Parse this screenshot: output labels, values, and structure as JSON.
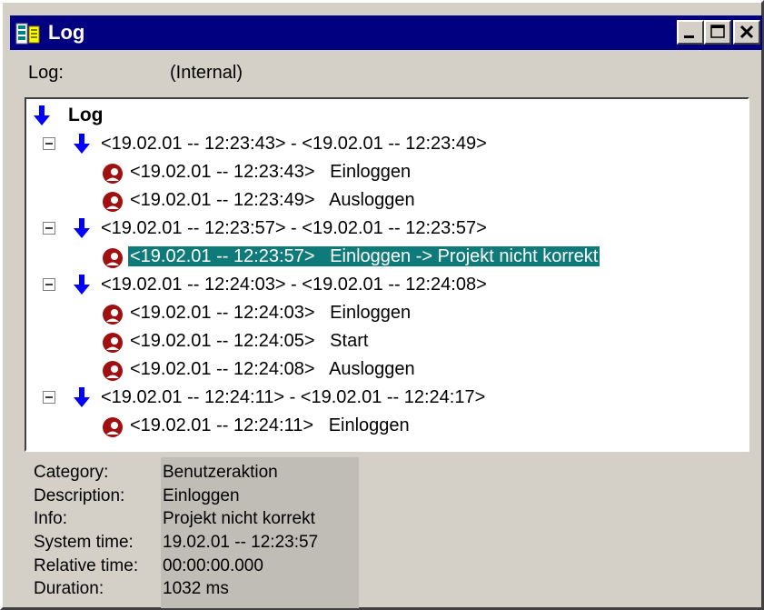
{
  "window": {
    "title": "Log",
    "icon": "log-book-icon",
    "controls": [
      "minimize-icon",
      "maximize-icon",
      "close-icon"
    ]
  },
  "log_selector": {
    "label": "Log:",
    "value": "(Internal)"
  },
  "tree": {
    "root_label": "Log",
    "groups": [
      {
        "label": "<19.02.01 -- 12:23:43> - <19.02.01 -- 12:23:49>",
        "entries": [
          {
            "time": "<19.02.01 -- 12:23:43>",
            "action": "Einloggen"
          },
          {
            "time": "<19.02.01 -- 12:23:49>",
            "action": "Ausloggen"
          }
        ]
      },
      {
        "label": "<19.02.01 -- 12:23:57> - <19.02.01 -- 12:23:57>",
        "entries": [
          {
            "time": "<19.02.01 -- 12:23:57>",
            "action": "Einloggen -> Projekt nicht korrekt",
            "selected": true
          }
        ]
      },
      {
        "label": "<19.02.01 -- 12:24:03> - <19.02.01 -- 12:24:08>",
        "entries": [
          {
            "time": "<19.02.01 -- 12:24:03>",
            "action": "Einloggen"
          },
          {
            "time": "<19.02.01 -- 12:24:05>",
            "action": "Start"
          },
          {
            "time": "<19.02.01 -- 12:24:08>",
            "action": "Ausloggen"
          }
        ]
      },
      {
        "label": "<19.02.01 -- 12:24:11> - <19.02.01 -- 12:24:17>",
        "entries": [
          {
            "time": "<19.02.01 -- 12:24:11>",
            "action": "Einloggen"
          }
        ]
      }
    ]
  },
  "details": [
    {
      "key": "Category:",
      "value": "Benutzeraktion"
    },
    {
      "key": "Description:",
      "value": "Einloggen"
    },
    {
      "key": "Info:",
      "value": "Projekt nicht korrekt"
    },
    {
      "key": "System time:",
      "value": "19.02.01 -- 12:23:57"
    },
    {
      "key": "Relative time:",
      "value": "00:00:00.000"
    },
    {
      "key": "Duration:",
      "value": "1032 ms"
    }
  ],
  "colors": {
    "titlebar": "#000080",
    "selection": "#0f7a7a",
    "arrow": "#0000ff",
    "window": "#d4d0c8"
  }
}
